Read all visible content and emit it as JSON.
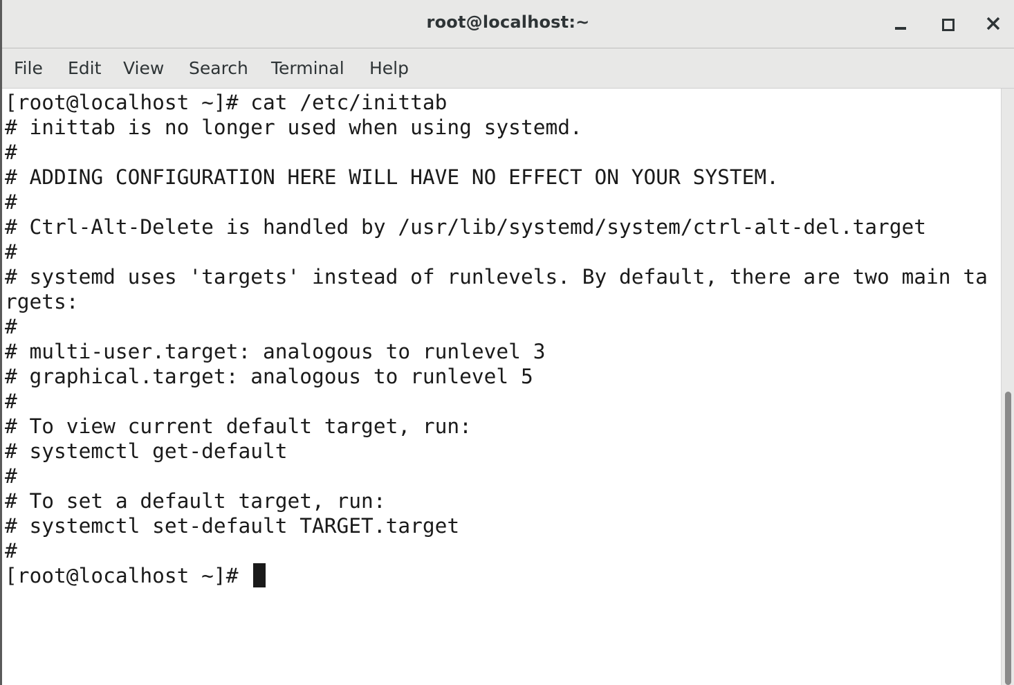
{
  "window": {
    "title": "root@localhost:~"
  },
  "controls": {
    "minimize_icon": "minimize-icon",
    "maximize_icon": "maximize-icon",
    "close_icon": "close-icon"
  },
  "menubar": {
    "items": [
      "File",
      "Edit",
      "View",
      "Search",
      "Terminal",
      "Help"
    ]
  },
  "terminal": {
    "lines": [
      "[root@localhost ~]# cat /etc/inittab",
      "# inittab is no longer used when using systemd.",
      "#",
      "# ADDING CONFIGURATION HERE WILL HAVE NO EFFECT ON YOUR SYSTEM.",
      "#",
      "# Ctrl-Alt-Delete is handled by /usr/lib/systemd/system/ctrl-alt-del.target",
      "#",
      "# systemd uses 'targets' instead of runlevels. By default, there are two main ta",
      "rgets:",
      "#",
      "# multi-user.target: analogous to runlevel 3",
      "# graphical.target: analogous to runlevel 5",
      "#",
      "# To view current default target, run:",
      "# systemctl get-default",
      "#",
      "# To set a default target, run:",
      "# systemctl set-default TARGET.target",
      "#",
      "[root@localhost ~]# "
    ]
  },
  "colors": {
    "titlebar": "#e8e8e7",
    "terminal_bg": "#ffffff",
    "terminal_fg": "#1a1a1a",
    "scroll_thumb": "#8a8a8a"
  }
}
